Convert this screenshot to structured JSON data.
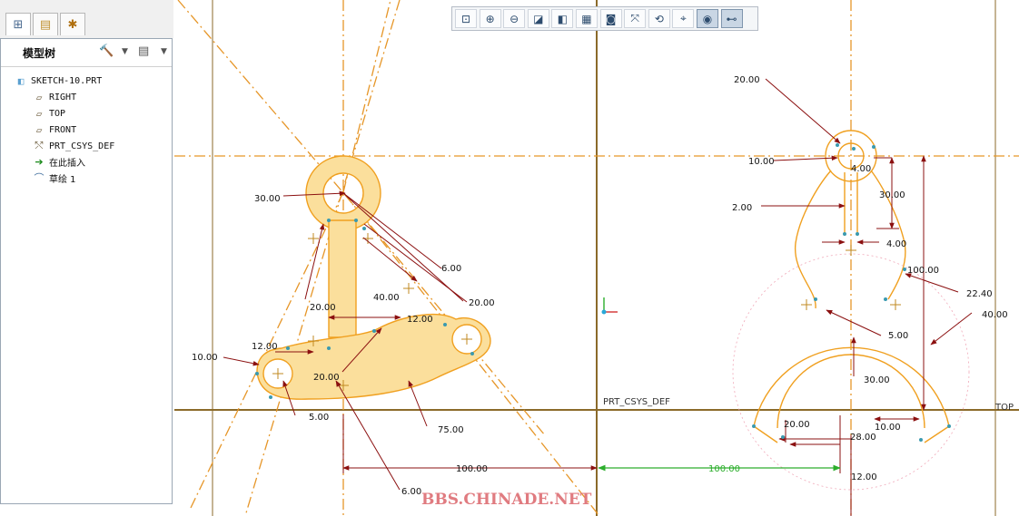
{
  "tabs": [
    {
      "name": "tab-model-tree",
      "icon": "tree-icon"
    },
    {
      "name": "tab-folder-browser",
      "icon": "folder-icon"
    },
    {
      "name": "tab-favorites",
      "icon": "favorites-icon"
    }
  ],
  "model_tree": {
    "title": "模型树",
    "settings_icon": "tools-icon",
    "show_icon": "document-icon",
    "items": [
      {
        "label": "SKETCH-10.PRT",
        "icon": "part-icon"
      },
      {
        "label": "RIGHT",
        "icon": "datum-plane-icon"
      },
      {
        "label": "TOP",
        "icon": "datum-plane-icon"
      },
      {
        "label": "FRONT",
        "icon": "datum-plane-icon"
      },
      {
        "label": "PRT_CSYS_DEF",
        "icon": "csys-icon"
      },
      {
        "label": "在此插入",
        "icon": "insert-arrow-icon"
      },
      {
        "label": "草绘 1",
        "icon": "sketch-icon"
      }
    ]
  },
  "toolbar": {
    "buttons": [
      "zoom-fit",
      "zoom-in",
      "zoom-out",
      "repaint",
      "shading",
      "saved-views",
      "display-style",
      "datum-display",
      "spin-center",
      "sketcher-display",
      "sketch-orient",
      "sketch-constraints"
    ],
    "pressed": [
      10,
      11
    ]
  },
  "sketch": {
    "dimensions": [
      "30.00",
      "6.00",
      "20.00",
      "40.00",
      "20.00",
      "12.00",
      "12.00",
      "10.00",
      "20.00",
      "5.00",
      "75.00",
      "100.00",
      "6.00",
      "20.00",
      "10.00",
      "4.00",
      "30.00",
      "2.00",
      "4.00",
      "100.00",
      "22.40",
      "40.00",
      "5.00",
      "30.00",
      "20.00",
      "28.00",
      "10.00",
      "12.00"
    ],
    "dim_100_green": "100.00",
    "csys_label": "PRT_CSYS_DEF",
    "top_label": "TOP"
  },
  "watermark": "BBS.CHINADE.NET",
  "colors": {
    "sketch": "#f0a020",
    "fill": "#fbdf9c",
    "dim": "#8b1010",
    "centerline": "#e69628",
    "datum": "#8b6a2a",
    "green": "#2cae2c",
    "watermark": "#e07b80",
    "tree_border": "#9aa7b4"
  }
}
